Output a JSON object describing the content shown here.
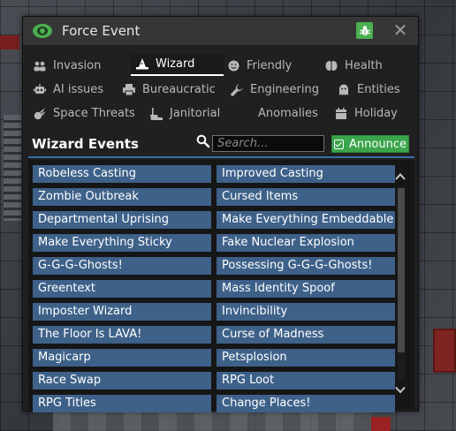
{
  "window": {
    "title": "Force Event",
    "close_glyph": "✕",
    "eye_icon_color": "#4caf50"
  },
  "tabs": [
    {
      "label": "Invasion",
      "icon": "users-icon"
    },
    {
      "label": "Wizard",
      "icon": "wizard-hat-icon",
      "active": true
    },
    {
      "label": "Friendly",
      "icon": "smile-icon"
    },
    {
      "label": "Health",
      "icon": "brain-icon"
    },
    {
      "label": "AI issues",
      "icon": "robot-icon"
    },
    {
      "label": "Bureaucratic",
      "icon": "print-icon"
    },
    {
      "label": "Engineering",
      "icon": "wrench-icon"
    },
    {
      "label": "Entities",
      "icon": "ghost-icon"
    },
    {
      "label": "Space Threats",
      "icon": "meteor-icon"
    },
    {
      "label": "Janitorial",
      "icon": "broom-icon"
    },
    {
      "label": "Anomalies",
      "icon": ""
    },
    {
      "label": "Holiday",
      "icon": "calendar-icon"
    }
  ],
  "section": {
    "title": "Wizard Events"
  },
  "search": {
    "placeholder": "Search...",
    "value": ""
  },
  "announce": {
    "label": "Announce",
    "checked": true
  },
  "events": [
    "Robeless Casting",
    "Improved Casting",
    "Zombie Outbreak",
    "Cursed Items",
    "Departmental Uprising",
    "Make Everything Embeddable",
    "Make Everything Sticky",
    "Fake Nuclear Explosion",
    "G-G-G-Ghosts!",
    "Possessing G-G-G-Ghosts!",
    "Greentext",
    "Mass Identity Spoof",
    "Imposter Wizard",
    "Invincibility",
    "The Floor Is LAVA!",
    "Curse of Madness",
    "Magicarp",
    "Petsplosion",
    "Race Swap",
    "RPG Loot",
    "RPG Titles",
    "Change Places!"
  ],
  "colors": {
    "accent_green": "#3aa54a",
    "event_button": "#3e6189",
    "divider_blue": "#3a6ea8"
  }
}
